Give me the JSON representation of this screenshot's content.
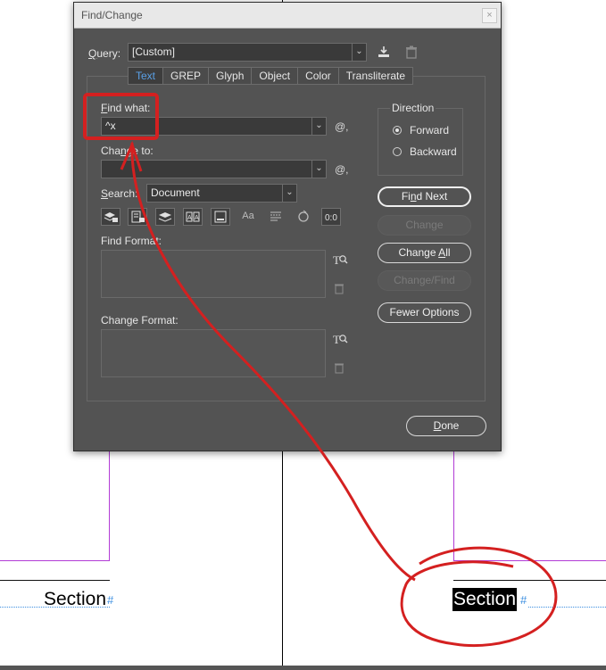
{
  "dialog": {
    "title": "Find/Change",
    "close_glyph": "×",
    "query_label_prefix": "Q",
    "query_label_rest": "uery:",
    "query_value": "[Custom]",
    "tabs": [
      "Text",
      "GREP",
      "Glyph",
      "Object",
      "Color",
      "Transliterate"
    ],
    "active_tab": "Text",
    "find_what_prefix": "F",
    "find_what_rest": "ind what:",
    "find_what_value": "^x",
    "change_to_prefix": "Cha",
    "change_to_underlined": "n",
    "change_to_rest": "ge to:",
    "change_to_value": "",
    "search_prefix": "S",
    "search_rest": "earch:",
    "search_value": "Document",
    "direction_label": "Direction",
    "direction_options": [
      "Forward",
      "Backward"
    ],
    "direction_selected": "Forward",
    "find_format_label": "Find Format:",
    "change_format_label": "Change Format:",
    "buttons": {
      "find_next_prefix": "Fi",
      "find_next_underlined": "n",
      "find_next_rest": "d Next",
      "change": "Change",
      "change_all_prefix": "Change ",
      "change_all_underlined": "A",
      "change_all_rest": "ll",
      "change_find": "Change/Find",
      "fewer_options": "Fewer Options",
      "done_prefix": "",
      "done_underlined": "D",
      "done_rest": "one"
    },
    "special_char_glyph": "@,",
    "type_icon_glyph": "Aa"
  },
  "document": {
    "left_text": "Section",
    "right_text": "Section",
    "end_mark": "#"
  },
  "colors": {
    "dialog_bg": "#535353",
    "accent_tab": "#5aa0e6",
    "annotation_red": "#d42020",
    "guide_magenta": "#b23bd6",
    "guide_blue": "#3b8ee0"
  },
  "icons": [
    "save-query-icon",
    "delete-query-icon",
    "lock-layers-icon",
    "lock-stories-icon",
    "hidden-layers-icon",
    "master-pages-icon",
    "footnotes-icon",
    "case-sensitive-icon",
    "whole-word-icon",
    "kana-sensitive-icon",
    "width-sensitive-icon",
    "specify-attributes-icon",
    "clear-attributes-icon"
  ]
}
